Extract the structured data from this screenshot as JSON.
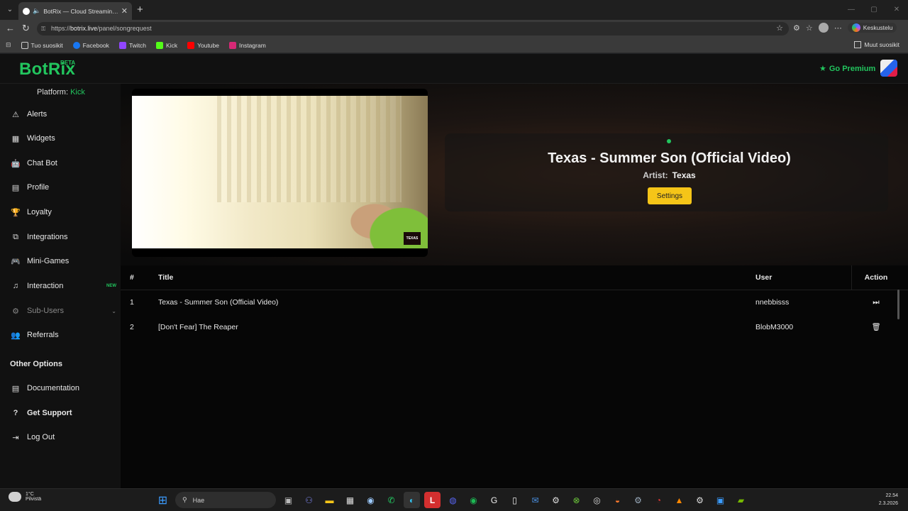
{
  "browser": {
    "tab_title": "BotRix — Cloud Streaming Bot",
    "url_scheme": "https://",
    "url_host": "botrix.live",
    "url_path": "/panel/songrequest",
    "copilot_label": "Keskustelu",
    "bookmarks": [
      {
        "label": "Tuo suosikit",
        "color": "#cccccc"
      },
      {
        "label": "Facebook",
        "color": "#1877f2"
      },
      {
        "label": "Twitch",
        "color": "#9146ff"
      },
      {
        "label": "Kick",
        "color": "#53fc18"
      },
      {
        "label": "Youtube",
        "color": "#ff0000"
      },
      {
        "label": "Instagram",
        "color": "#d62976"
      }
    ],
    "other_bookmarks": "Muut suosikit"
  },
  "header": {
    "brand": "BotRix",
    "beta": "BETA",
    "premium": "Go Premium"
  },
  "sidebar": {
    "platform_label": "Platform:",
    "platform_value": "Kick",
    "items": [
      {
        "label": "Alerts",
        "icon": "⚠"
      },
      {
        "label": "Widgets",
        "icon": "▦"
      },
      {
        "label": "Chat Bot",
        "icon": "🤖"
      },
      {
        "label": "Profile",
        "icon": "▤"
      },
      {
        "label": "Loyalty",
        "icon": "🏆"
      },
      {
        "label": "Integrations",
        "icon": "⧉"
      },
      {
        "label": "Mini-Games",
        "icon": "🎮"
      },
      {
        "label": "Interaction",
        "icon": "♫",
        "badge": "NEW"
      },
      {
        "label": "Sub-Users",
        "icon": "⚙"
      },
      {
        "label": "Referrals",
        "icon": "👥"
      }
    ],
    "other_title": "Other Options",
    "other_items": [
      {
        "label": "Documentation",
        "icon": "▤"
      },
      {
        "label": "Get Support",
        "icon": "?"
      },
      {
        "label": "Log Out",
        "icon": "⇥"
      }
    ]
  },
  "now_playing": {
    "title": "Texas - Summer Son (Official Video)",
    "artist_label": "Artist:",
    "artist": "Texas",
    "settings": "Settings",
    "video_logo": "TEXAS"
  },
  "queue": {
    "columns": [
      "#",
      "Title",
      "User",
      "Action"
    ],
    "rows": [
      {
        "num": "1",
        "title": "Texas - Summer Son (Official Video)",
        "user": "nnebbisss",
        "action": "⏭"
      },
      {
        "num": "2",
        "title": "[Don't Fear] The Reaper",
        "user": "BlobM3000",
        "action": "🗑"
      }
    ]
  },
  "taskbar": {
    "temp": "1°C",
    "weather": "Pilvistä",
    "search": "Hae",
    "time": "22.54",
    "date": "2.3.2026"
  }
}
